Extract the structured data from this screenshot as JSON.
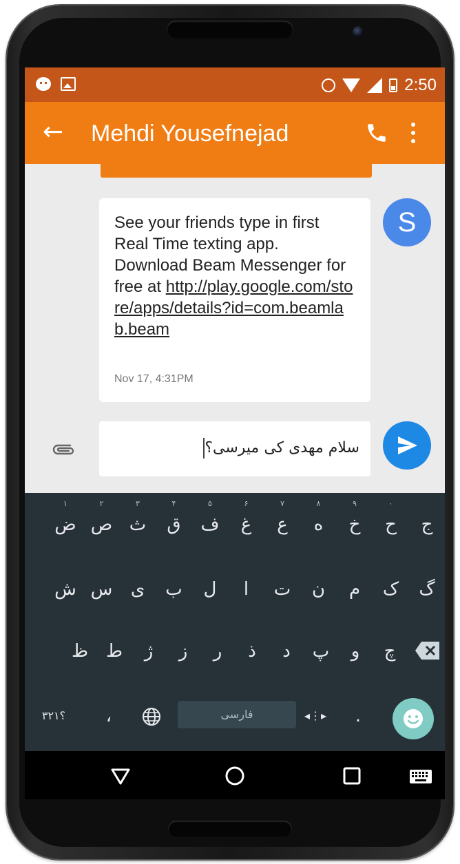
{
  "status_bar": {
    "time": "2:50",
    "icons": [
      "hangouts-notification-icon",
      "image-notification-icon",
      "alarm-icon",
      "wifi-icon",
      "signal-icon",
      "battery-icon"
    ]
  },
  "toolbar": {
    "contact_name": "Mehdi Yousefnejad",
    "actions": [
      "back-arrow-icon",
      "phone-call-icon",
      "more-vert-icon"
    ]
  },
  "message": {
    "text_before_link": "See your friends type in first Real Time texting app. Download Beam Messenger for free at ",
    "link": "http://play.google.com/store/apps/details?id=com.beamlab.beam",
    "timestamp": "Nov 17, 4:31PM",
    "avatar_letter": "S"
  },
  "compose": {
    "value": "سلام مهدی کی میرسی؟"
  },
  "keyboard": {
    "row1": [
      "ج",
      "ح",
      "خ",
      "ه",
      "ع",
      "غ",
      "ف",
      "ق",
      "ث",
      "ص",
      "ض"
    ],
    "row1_hints": [
      "",
      "۰",
      "۹",
      "۸",
      "۷",
      "۶",
      "۵",
      "۴",
      "۳",
      "۲",
      "۱"
    ],
    "row2": [
      "گ",
      "ک",
      "م",
      "ن",
      "ت",
      "ا",
      "ل",
      "ب",
      "ی",
      "س",
      "ش"
    ],
    "row3": [
      "چ",
      "و",
      "پ",
      "د",
      "ذ",
      "ر",
      "ز",
      "ژ",
      "ط",
      "ظ"
    ],
    "symbols_key": "؟۳۲۱",
    "comma_key": "،",
    "space_label": "فارسی",
    "period_key": "."
  },
  "colors": {
    "toolbar": "#f07d14",
    "status_bar": "#c5561a",
    "avatar": "#4a89e8",
    "send": "#1e88e5",
    "keyboard_bg": "#263238",
    "emoji": "#80cbc4"
  }
}
